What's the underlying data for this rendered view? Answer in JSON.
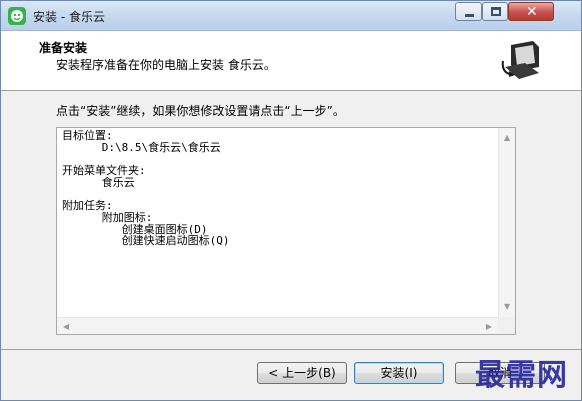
{
  "window": {
    "title": "安装 - 食乐云",
    "controls": {
      "minimize": "minimize",
      "maximize": "maximize",
      "close": "✕"
    }
  },
  "header": {
    "title": "准备安装",
    "subtitle": "安装程序准备在你的电脑上安装 食乐云。"
  },
  "instruction": "点击“安装”继续，如果你想修改设置请点击“上一步”。",
  "memo": {
    "lines": [
      "目标位置:",
      "      D:\\8.5\\食乐云\\食乐云",
      "",
      "开始菜单文件夹:",
      "      食乐云",
      "",
      "附加任务:",
      "      附加图标:",
      "         创建桌面图标(D)",
      "         创建快速启动图标(Q)"
    ]
  },
  "buttons": {
    "back": "< 上一步(B)",
    "install": "安装(I)",
    "cancel": "取消"
  },
  "watermark": "最需网",
  "colors": {
    "titlebar": "#c3d6ee",
    "close_button": "#c75050",
    "app_icon": "#35b34a",
    "watermark": "#2a2aa0"
  }
}
